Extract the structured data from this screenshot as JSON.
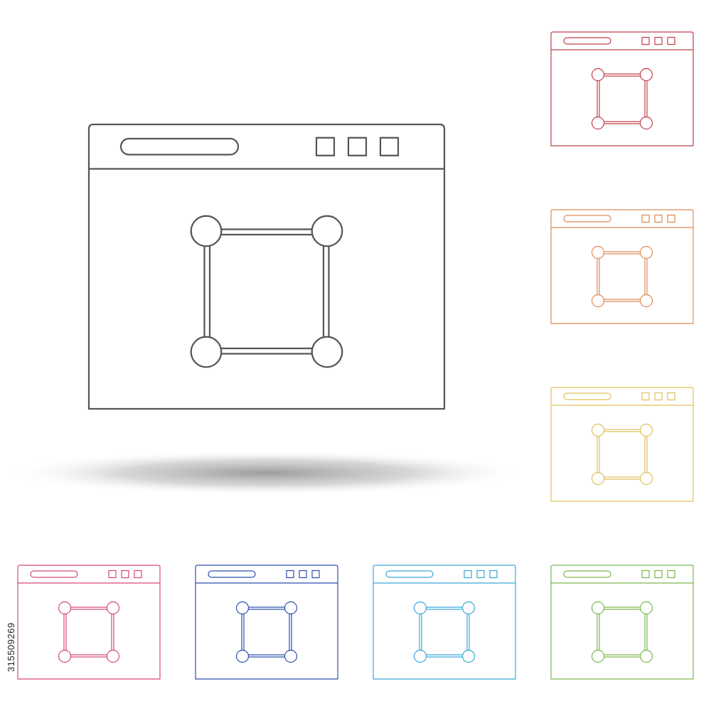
{
  "icon_name": "browser-window-vector-select-icon",
  "colors": {
    "main": "#555555",
    "shadow": "#9a9a9a",
    "variants": {
      "red": "#c0404a",
      "orange": "#dd8a55",
      "yellow": "#e0c05a",
      "pink": "#d8467e",
      "blue": "#2f4fae",
      "light-blue": "#3ba8d8",
      "green": "#7ab84a"
    }
  },
  "watermark": {
    "text": "315509269"
  }
}
